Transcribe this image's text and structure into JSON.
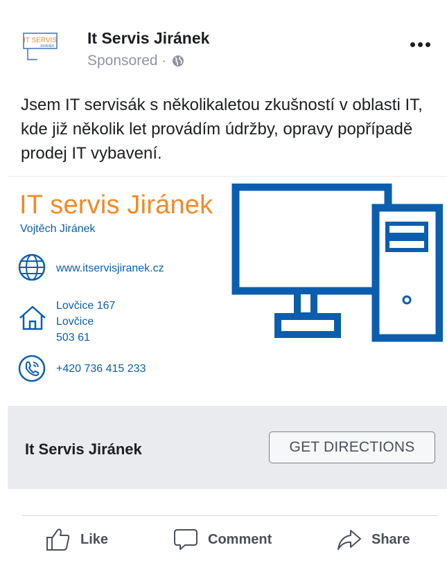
{
  "header": {
    "page_name": "It Servis Jiránek",
    "sponsored_label": "Sponsored ·",
    "logo": {
      "line1": "IT SERVIS",
      "line2": "JIRÁNEK"
    }
  },
  "post": {
    "text": "Jsem IT servisák s několikaletou zkušností v oblasti IT, kde již několik let provádím údržby, opravy popřípadě prodej IT vybavení."
  },
  "ad": {
    "brand_title": "IT servis Jiránek",
    "owner": "Vojtěch Jiránek",
    "website": "www.itservisjiranek.cz",
    "address": {
      "line1": "Lovčice 167",
      "line2": "Lovčice",
      "line3": "503 61"
    },
    "phone": "+420 736 415 233",
    "colors": {
      "brand_orange": "#f08a28",
      "brand_blue": "#0b5ead"
    }
  },
  "cta": {
    "title": "It Servis Jiránek",
    "button_label": "GET DIRECTIONS"
  },
  "actions": {
    "like": "Like",
    "comment": "Comment",
    "share": "Share"
  }
}
